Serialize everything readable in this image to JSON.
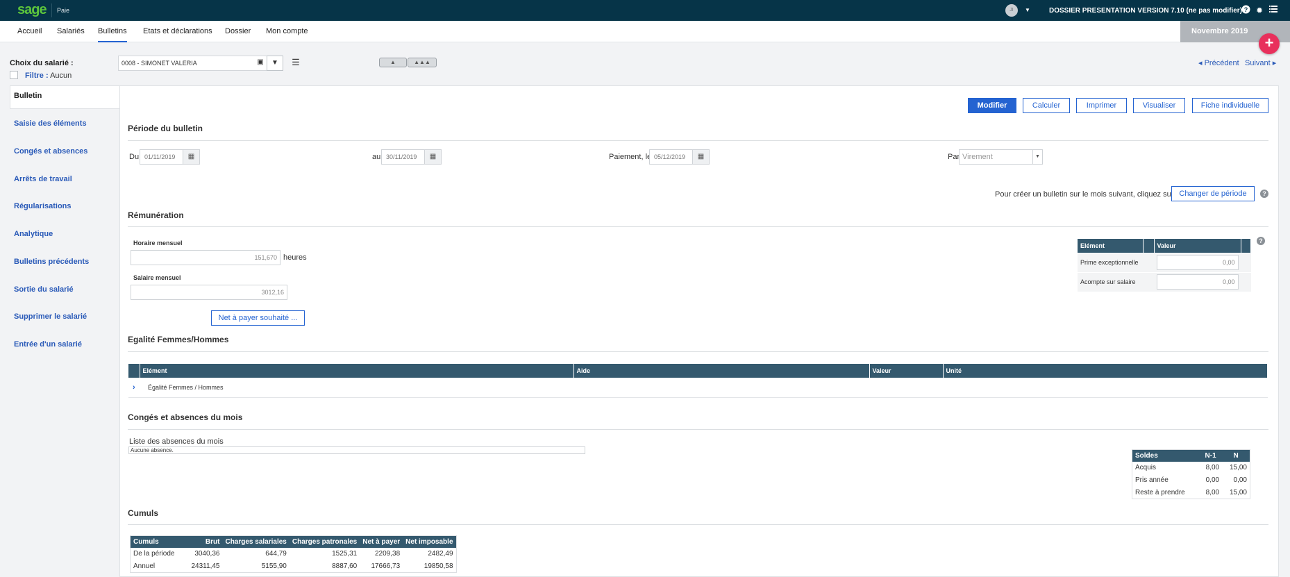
{
  "topbar": {
    "logo": "sage",
    "app": "Paie",
    "avatar": "JI",
    "dossier": "DOSSIER PRESENTATION VERSION 7.10 (ne pas modifier) ▾"
  },
  "nav": {
    "items": [
      "Accueil",
      "Salariés",
      "Bulletins",
      "Etats et déclarations",
      "Dossier",
      "Mon compte"
    ],
    "active": "Bulletins",
    "month": "Novembre 2019"
  },
  "employee": {
    "choice_label": "Choix du salarié :",
    "filter_label": "Filtre :",
    "filter_value": "Aucun",
    "selected": "0008 - SIMONET VALERIA",
    "prev": "◂ Précédent",
    "next": "Suivant ▸"
  },
  "sidebar": {
    "items": [
      "Bulletin",
      "Saisie des éléments",
      "Congés et absences",
      "Arrêts de travail",
      "Régularisations",
      "Analytique",
      "Bulletins précédents",
      "Sortie du salarié",
      "Supprimer le salarié",
      "Entrée d'un salarié"
    ]
  },
  "actions": {
    "modifier": "Modifier",
    "calculer": "Calculer",
    "imprimer": "Imprimer",
    "visualiser": "Visualiser",
    "fiche": "Fiche individuelle"
  },
  "periode": {
    "title": "Période du bulletin",
    "du_label": "Du",
    "du_value": "01/11/2019",
    "au_label": "au",
    "au_value": "30/11/2019",
    "paiement_label": "Paiement, le",
    "paiement_value": "05/12/2019",
    "par_label": "Par",
    "par_value": "Virement",
    "next_text": "Pour créer un bulletin sur le mois suivant, cliquez sur :",
    "changer": "Changer de période"
  },
  "remuneration": {
    "title": "Rémunération",
    "horaire_label": "Horaire mensuel",
    "horaire_value": "151,670",
    "heures": "heures",
    "salaire_label": "Salaire mensuel",
    "salaire_value": "3012,16",
    "net_button": "Net à payer souhaité ...",
    "elements_headers": [
      "Elément",
      "Valeur"
    ],
    "elements": [
      {
        "label": "Prime exceptionnelle",
        "value": "0,00"
      },
      {
        "label": "Acompte sur salaire",
        "value": "0,00"
      }
    ]
  },
  "egalite": {
    "title": "Egalité Femmes/Hommes",
    "headers": [
      "Elément",
      "Aide",
      "Valeur",
      "Unité"
    ],
    "row": "Égalité Femmes / Hommes"
  },
  "conges": {
    "title": "Congés et absences du mois",
    "list_label": "Liste des absences du mois",
    "list_value": "Aucune absence.",
    "soldes_headers": [
      "Soldes",
      "N-1",
      "N"
    ],
    "soldes": [
      [
        "Acquis",
        "8,00",
        "15,00"
      ],
      [
        "Pris année",
        "0,00",
        "0,00"
      ],
      [
        "Reste à prendre",
        "8,00",
        "15,00"
      ]
    ]
  },
  "cumuls": {
    "title": "Cumuls",
    "headers": [
      "Cumuls",
      "Brut",
      "Charges salariales",
      "Charges patronales",
      "Net à payer",
      "Net imposable"
    ],
    "rows": [
      [
        "De la période",
        "3040,36",
        "644,79",
        "1525,31",
        "2209,38",
        "2482,49"
      ],
      [
        "Annuel",
        "24311,45",
        "5155,90",
        "8887,60",
        "17666,73",
        "19850,58"
      ]
    ]
  }
}
